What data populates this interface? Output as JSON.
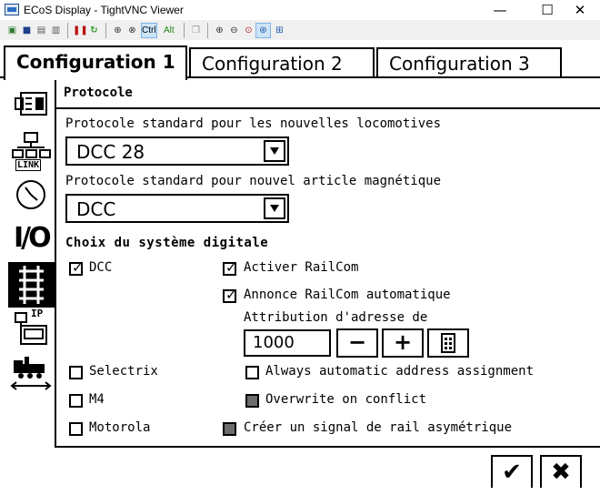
{
  "window": {
    "title": "ECoS Display - TightVNC Viewer",
    "minimize": "—",
    "maximize": "☐",
    "close": "✕"
  },
  "toolbar": {
    "ctrl": "Ctrl",
    "alt": "Alt"
  },
  "tabs": [
    {
      "label": "Configuration 1"
    },
    {
      "label": "Configuration 2"
    },
    {
      "label": "Configuration 3"
    }
  ],
  "sidebar": {
    "link_label": "LINK",
    "io_label": "I/O",
    "ip_label": "IP"
  },
  "panel": {
    "title": "Protocole",
    "loco_protocol_label": "Protocole standard pour les nouvelles locomotives",
    "loco_protocol_value": "DCC 28",
    "accessory_protocol_label": "Protocole standard pour nouvel article magnétique",
    "accessory_protocol_value": "DCC",
    "digital_system_heading": "Choix du système digitale",
    "options": {
      "dcc": "DCC",
      "selectrix": "Selectrix",
      "m4": "M4",
      "motorola": "Motorola",
      "railcom": "Activer RailCom",
      "railcom_auto": "Annonce RailCom automatique",
      "address_label": "Attribution d'adresse de",
      "address_value": "1000",
      "minus": "−",
      "plus": "+",
      "always_auto": "Always automatic address assignment",
      "overwrite": "Overwrite on conflict",
      "asymmetric": "Créer un signal de rail asymétrique"
    }
  },
  "footer": {
    "ok": "✔",
    "cancel": "✖"
  }
}
